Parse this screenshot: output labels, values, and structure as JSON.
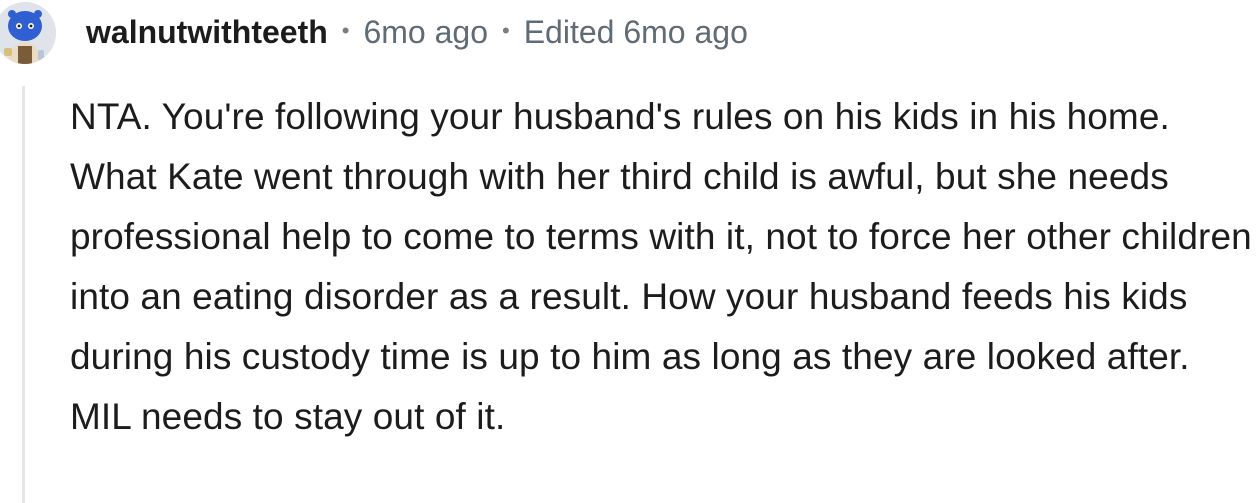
{
  "comment": {
    "author": "walnutwithteeth",
    "separator": "•",
    "posted": "6mo ago",
    "edited": "Edited 6mo ago",
    "body": "NTA. You're following your husband's rules on his kids in his home. What Kate went through with her third child is awful, but she needs professional help to come to terms with it, not to force her other children into an eating disorder as a result. How your husband feeds his kids during his custody time is up to him as long as they are looked after. MIL needs to stay out of it."
  },
  "icons": {
    "avatar": "snoo-avatar-icon"
  },
  "colors": {
    "text": "#1c1c1c",
    "meta": "#5f6b75",
    "thread_line": "#e6e6e6",
    "avatar_blue": "#2f5fd0"
  }
}
